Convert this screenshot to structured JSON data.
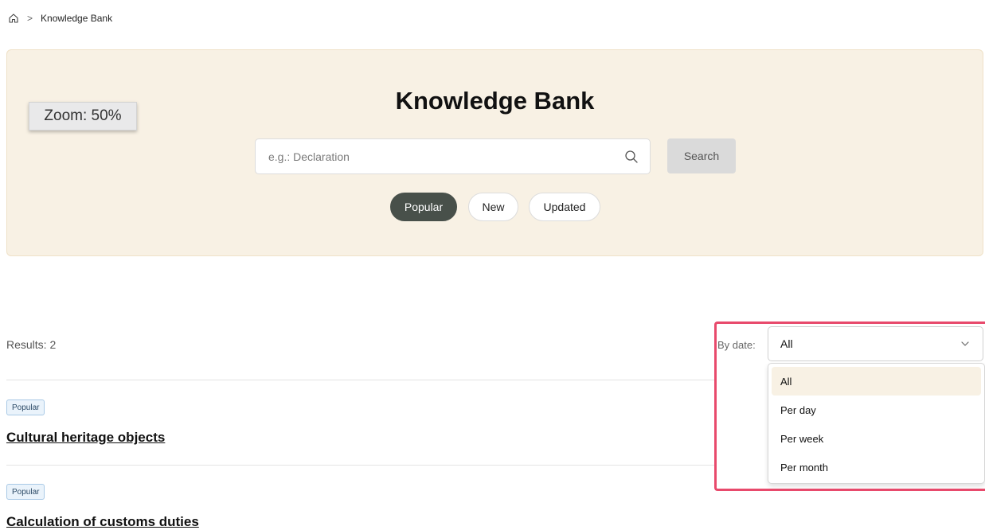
{
  "breadcrumb": {
    "current": "Knowledge Bank",
    "separator": ">"
  },
  "zoom": {
    "label": "Zoom: 50%"
  },
  "hero": {
    "title": "Knowledge Bank",
    "search": {
      "placeholder": "e.g.: Declaration",
      "value": "",
      "button": "Search"
    },
    "filters": [
      "Popular",
      "New",
      "Updated"
    ],
    "active_filter": "Popular"
  },
  "results": {
    "label": "Results: 2",
    "items": [
      {
        "tag": "Popular",
        "title": "Cultural heritage objects"
      },
      {
        "tag": "Popular",
        "title": "Calculation of customs duties"
      }
    ]
  },
  "date_filter": {
    "label": "By date:",
    "selected": "All",
    "options": [
      "All",
      "Per day",
      "Per week",
      "Per month"
    ]
  },
  "colors": {
    "hero_bg": "#f8f1e4",
    "active_pill": "#48504a",
    "highlight": "#e84a6c",
    "tag_bg": "#eaf3fb"
  }
}
